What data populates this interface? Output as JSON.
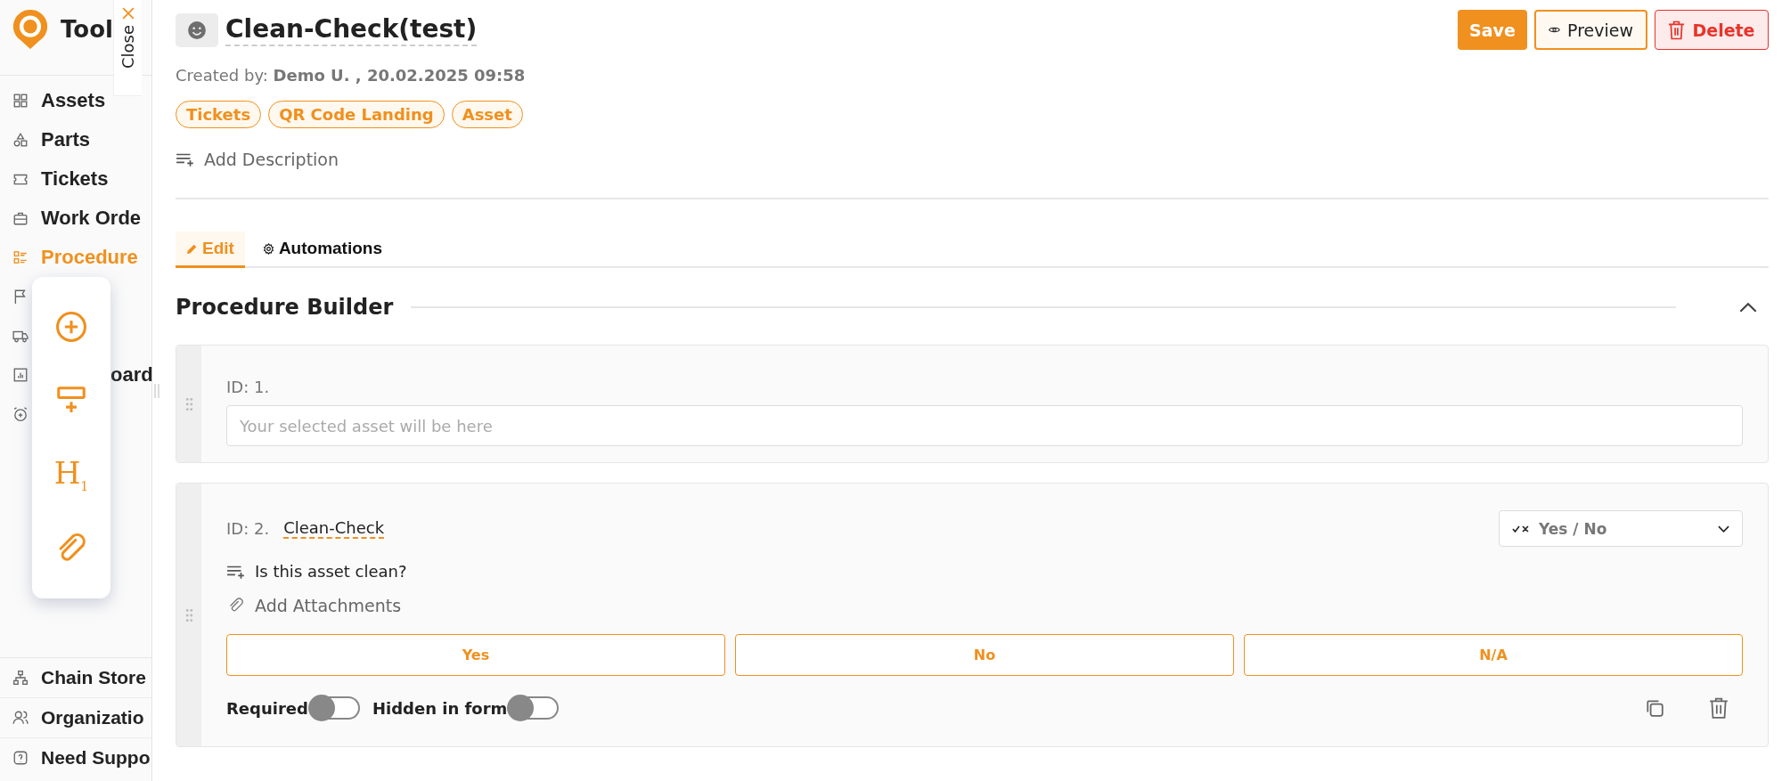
{
  "sidebar": {
    "brand": "Tool",
    "close_label": "Close",
    "items": [
      {
        "label": "Assets",
        "selected": false
      },
      {
        "label": "Parts",
        "selected": false
      },
      {
        "label": "Tickets",
        "selected": false
      },
      {
        "label": "Work Orde",
        "selected": false
      },
      {
        "label": "Procedure",
        "selected": true
      },
      {
        "selected": false
      },
      {
        "selected": false
      },
      {
        "label": "oard",
        "selected": false
      },
      {
        "selected": false
      }
    ],
    "bottom_items": [
      {
        "label": "Chain Store"
      },
      {
        "label": "Organizatio"
      },
      {
        "label": "Need Suppo"
      }
    ]
  },
  "floating_toolbar": {
    "heading": "H$_{1}$"
  },
  "header": {
    "title": "Clean-Check(test)",
    "created_by": "Created by: **Demo U. , 20.02.2025 09:58**",
    "tags": [
      "Tickets",
      "QR Code Landing",
      "Asset"
    ],
    "add_description": "Add Description",
    "actions": [
      {
        "kind": "save",
        "label": "Save"
      },
      {
        "kind": "preview",
        "label": "Preview"
      },
      {
        "kind": "delete",
        "label": "Delete"
      }
    ]
  },
  "tabs": [
    {
      "label": "Edit",
      "selected": true
    },
    {
      "label": "Automations",
      "selected": false
    }
  ],
  "builder": {
    "title": "Procedure Builder",
    "expanded": true,
    "steps": [
      {
        "kind": "asset",
        "id_label": "ID: 1.",
        "placeholder": "Your selected asset will be here"
      },
      {
        "kind": "yes_no",
        "id_label": "ID: 2.",
        "name": "Clean-Check",
        "answer_type": "Yes / No",
        "question": "Is this asset clean?",
        "attachments_label": "Add Attachments",
        "options": [
          "Yes",
          "No",
          "N/A"
        ],
        "toggles": [
          {
            "label": "Required",
            "on": false
          },
          {
            "label": "Hidden in form",
            "on": false
          }
        ]
      }
    ]
  }
}
